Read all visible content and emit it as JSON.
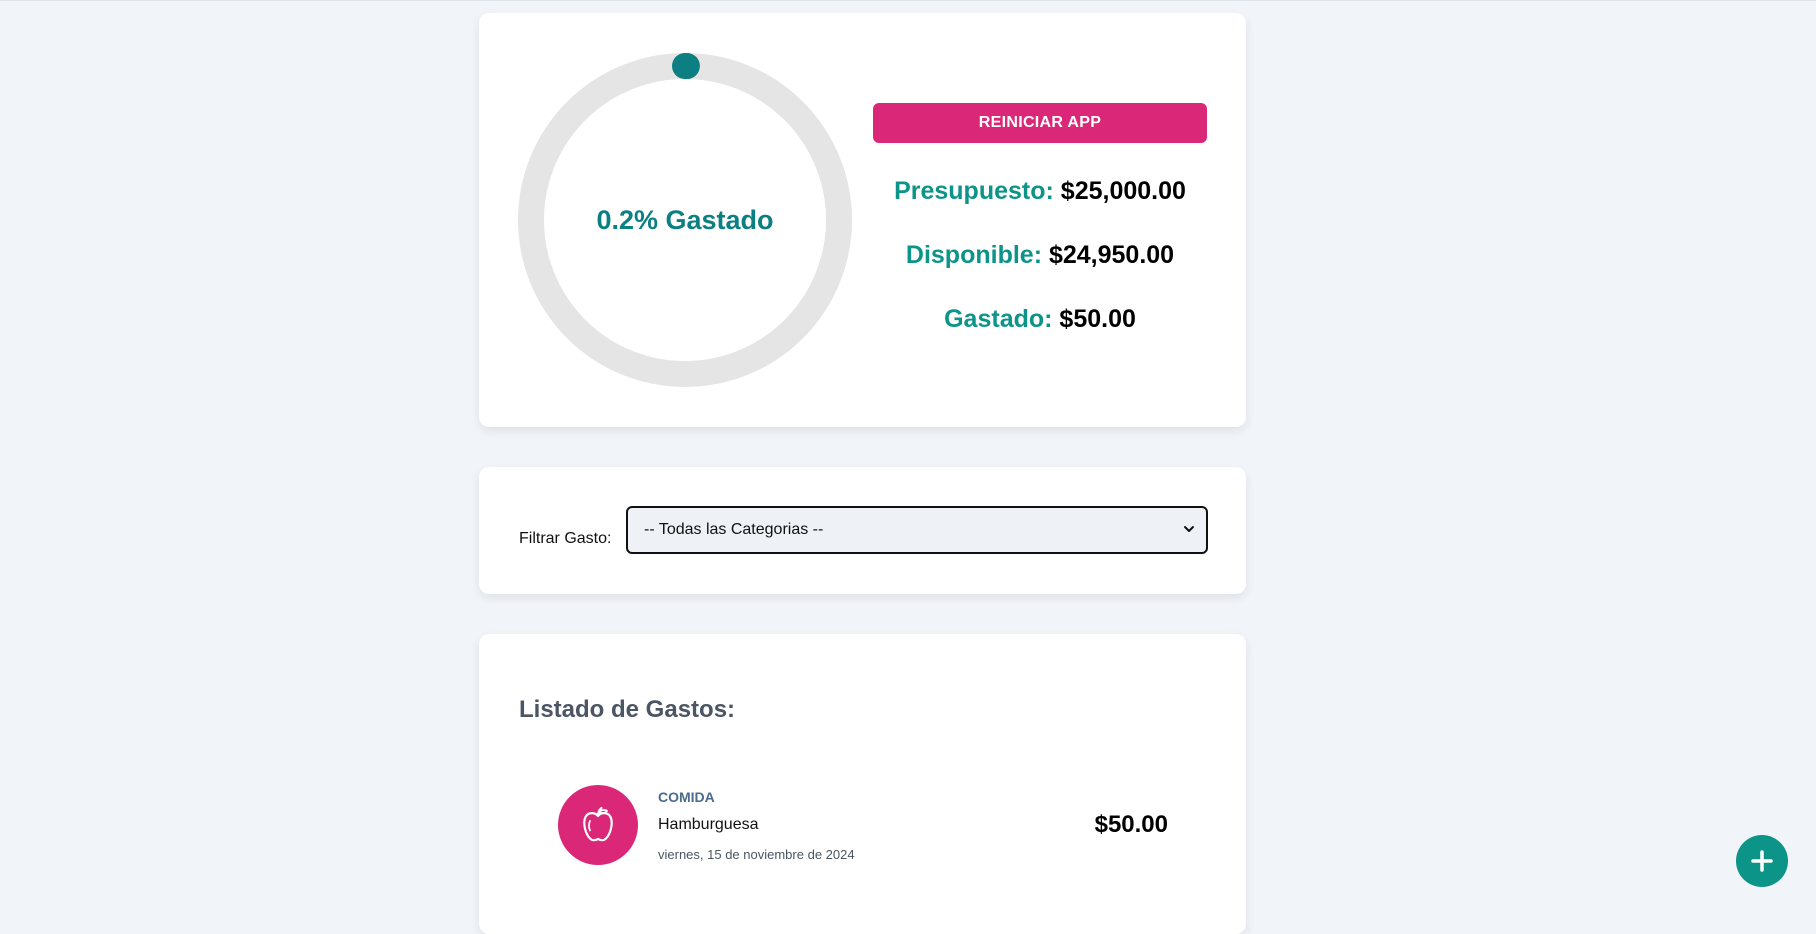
{
  "budget_panel": {
    "progress": {
      "percent_spent": 0.2,
      "label": "0.2% Gastado",
      "track_color": "#e5e5e5",
      "fill_color": "#0c7f82"
    },
    "reset_button_label": "Reiniciar App",
    "stats": {
      "budget_label": "Presupuesto:",
      "budget_value": "$25,000.00",
      "available_label": "Disponible:",
      "available_value": "$24,950.00",
      "spent_label": "Gastado:",
      "spent_value": "$50.00"
    }
  },
  "filter": {
    "label": "Filtrar Gasto:",
    "selected_option": "-- Todas las Categorias --"
  },
  "expenses": {
    "title": "Listado de Gastos:",
    "items": [
      {
        "category": "Comida",
        "icon": "apple-icon",
        "name": "Hamburguesa",
        "date": "viernes, 15 de noviembre de 2024",
        "amount": "$50.00"
      }
    ]
  },
  "fab": {
    "icon": "plus-icon"
  },
  "colors": {
    "accent_teal": "#0d9488",
    "accent_pink": "#db2777",
    "background": "#f1f4f9"
  }
}
